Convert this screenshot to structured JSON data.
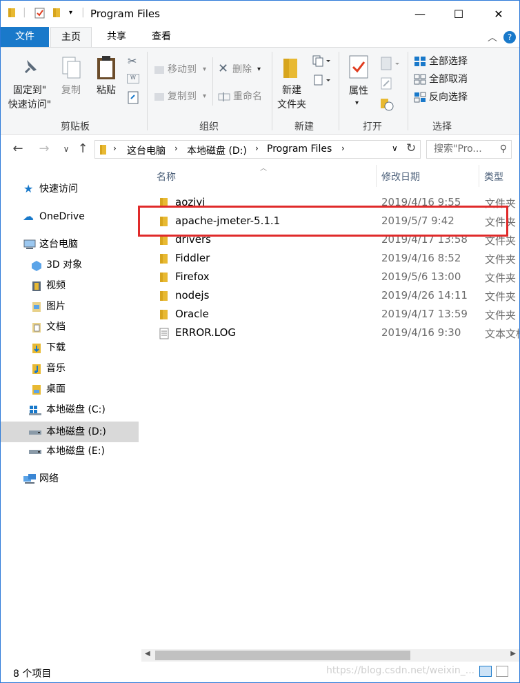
{
  "window": {
    "title": "Program Files"
  },
  "titlebar": {
    "minimize": "—",
    "maximize": "☐",
    "close": "✕"
  },
  "tabs": {
    "file": "文件",
    "home": "主页",
    "share": "共享",
    "view": "查看"
  },
  "ribbon": {
    "pin_line1": "固定到\"",
    "pin_line2": "快速访问\"",
    "copy": "复制",
    "paste": "粘贴",
    "move_to": "移动到",
    "copy_to": "复制到",
    "delete": "删除",
    "rename": "重命名",
    "new_folder_line1": "新建",
    "new_folder_line2": "文件夹",
    "properties": "属性",
    "select_all": "全部选择",
    "select_none": "全部取消",
    "invert_selection": "反向选择",
    "groups": {
      "clipboard": "剪贴板",
      "organize": "组织",
      "new": "新建",
      "open": "打开",
      "select": "选择"
    }
  },
  "address": {
    "crumbs": [
      "这台电脑",
      "本地磁盘 (D:)",
      "Program Files"
    ],
    "search_placeholder": "搜索\"Pro..."
  },
  "sidebar": {
    "quick_access": "快速访问",
    "onedrive": "OneDrive",
    "this_pc": "这台电脑",
    "items": [
      "3D 对象",
      "视频",
      "图片",
      "文档",
      "下载",
      "音乐",
      "桌面",
      "本地磁盘 (C:)",
      "本地磁盘 (D:)",
      "本地磁盘 (E:)"
    ],
    "network": "网络"
  },
  "columns": {
    "name": "名称",
    "date": "修改日期",
    "type": "类型"
  },
  "files": [
    {
      "name": "aoziyi",
      "date": "2019/4/16 9:55",
      "type": "文件夹"
    },
    {
      "name": "apache-jmeter-5.1.1",
      "date": "2019/5/7 9:42",
      "type": "文件夹"
    },
    {
      "name": "drivers",
      "date": "2019/4/17 13:58",
      "type": "文件夹"
    },
    {
      "name": "Fiddler",
      "date": "2019/4/16 8:52",
      "type": "文件夹"
    },
    {
      "name": "Firefox",
      "date": "2019/5/6 13:00",
      "type": "文件夹"
    },
    {
      "name": "nodejs",
      "date": "2019/4/26 14:11",
      "type": "文件夹"
    },
    {
      "name": "Oracle",
      "date": "2019/4/17 13:59",
      "type": "文件夹"
    },
    {
      "name": "ERROR.LOG",
      "date": "2019/4/16 9:30",
      "type": "文本文档"
    }
  ],
  "status": {
    "count": "8 个项目"
  },
  "watermark": "https://blog.csdn.net/weixin_..."
}
